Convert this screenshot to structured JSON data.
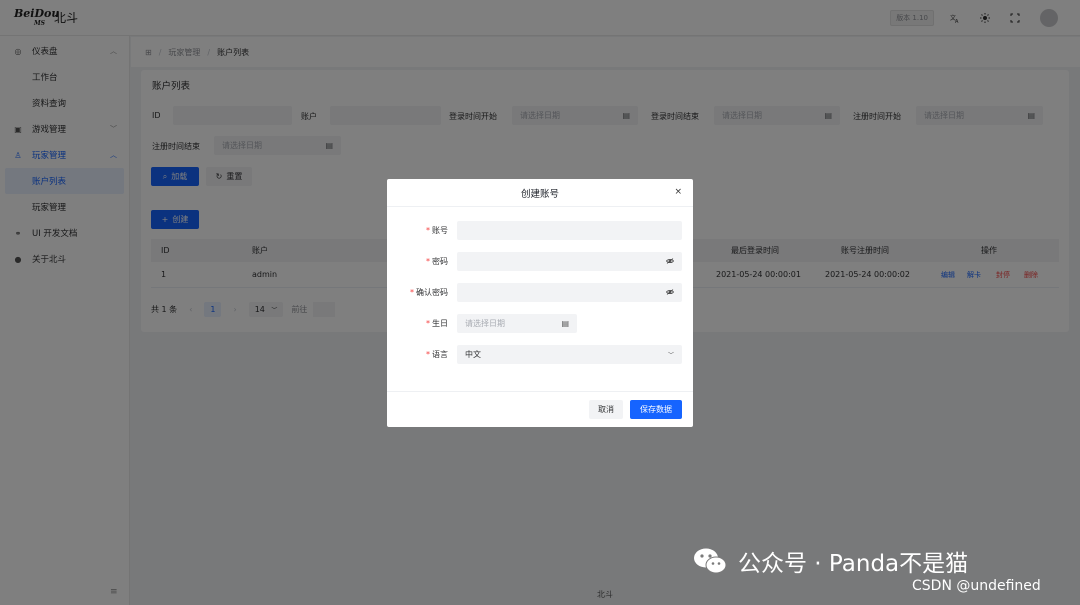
{
  "header": {
    "logo_text": "BeiDou",
    "logo_sub": "MS",
    "app_title": "北斗",
    "version": "版本 1.10",
    "icons": [
      "translate-icon",
      "theme-icon",
      "fullscreen-icon"
    ]
  },
  "sidebar": {
    "items": [
      {
        "label": "仪表盘",
        "icon": "dashboard-icon"
      },
      {
        "label": "工作台"
      },
      {
        "label": "资料查询"
      },
      {
        "label": "游戏管理",
        "icon": "game-icon"
      },
      {
        "label": "玩家管理",
        "icon": "user-icon"
      },
      {
        "label": "账户列表"
      },
      {
        "label": "玩家管理"
      },
      {
        "label": "UI 开发文档",
        "icon": "link-icon"
      },
      {
        "label": "关于北斗",
        "icon": "github-icon"
      }
    ],
    "collapse_symbol": "≡"
  },
  "breadcrumb": {
    "home_icon": "⊞",
    "items": [
      "玩家管理",
      "账户列表"
    ]
  },
  "page": {
    "title": "账户列表",
    "filters": {
      "id_label": "ID",
      "account_label": "账户",
      "login_start_label": "登录时间开始",
      "login_end_label": "登录时间结束",
      "reg_start_label": "注册时间开始",
      "reg_end_label": "注册时间结束",
      "date_placeholder": "请选择日期"
    },
    "load_label": "加载",
    "reset_label": "重置",
    "create_label": "创建",
    "table": {
      "columns": [
        "ID",
        "账户",
        "最后登录时间",
        "账号注册时间",
        "操作"
      ],
      "rows": [
        {
          "id": "1",
          "account": "admin",
          "last_login": "2021-05-24 00:00:01",
          "registered": "2021-05-24 00:00:02",
          "actions": [
            "编辑",
            "解卡",
            "封停",
            "删除"
          ]
        }
      ]
    },
    "pager": {
      "total": "共 1 条",
      "prev": "‹",
      "page": "1",
      "next": "›",
      "page_size": "14",
      "goto_label": "前往"
    },
    "footer": "北斗"
  },
  "modal": {
    "title": "创建账号",
    "close": "×",
    "fields": {
      "account_label": "账号",
      "password_label": "密码",
      "confirm_label": "确认密码",
      "birthday_label": "生日",
      "birthday_placeholder": "请选择日期",
      "language_label": "语言",
      "language_value": "中文"
    },
    "cancel_label": "取消",
    "save_label": "保存数据"
  },
  "watermark": {
    "line1": "公众号 · Panda不是猫",
    "line2": "CSDN @undefined"
  },
  "colors": {
    "primary": "#1664ff",
    "danger": "#f53f3f",
    "mask": "rgba(0,0,0,0.5)"
  }
}
